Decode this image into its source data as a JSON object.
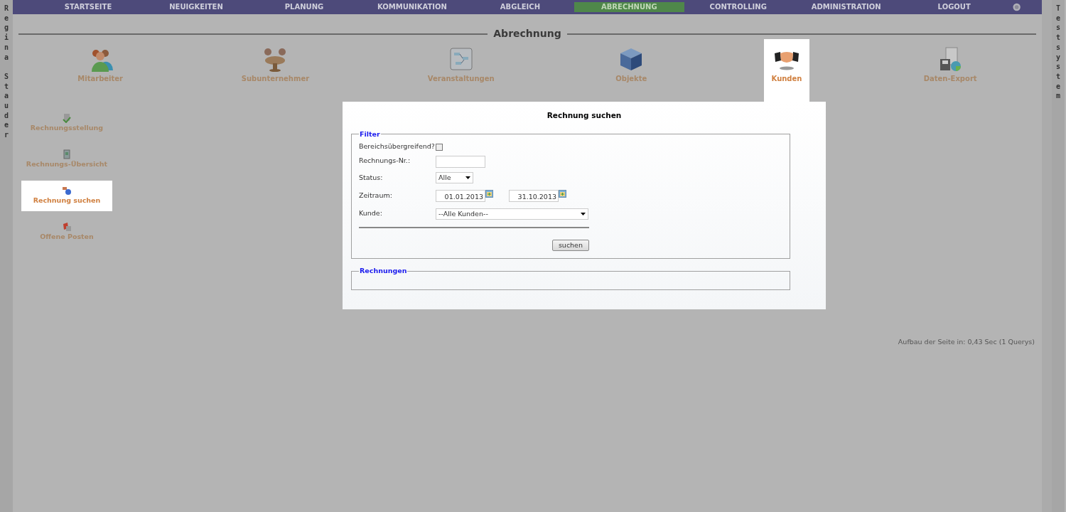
{
  "user_strip": "Regina Stauder",
  "system_strip": "Testsystem",
  "nav": [
    {
      "label": "STARTSEITE",
      "selected": false
    },
    {
      "label": "NEUIGKEITEN",
      "selected": false
    },
    {
      "label": "PLANUNG",
      "selected": false
    },
    {
      "label": "KOMMUNIKATION",
      "selected": false
    },
    {
      "label": "ABGLEICH",
      "selected": false
    },
    {
      "label": "ABRECHNUNG",
      "selected": true
    },
    {
      "label": "CONTROLLING",
      "selected": false
    },
    {
      "label": "ADMINISTRATION",
      "selected": false
    },
    {
      "label": "LOGOUT",
      "selected": false
    }
  ],
  "section_title": "Abrechnung",
  "modules": [
    {
      "kind": "people",
      "label": "Mitarbeiter",
      "selected": false
    },
    {
      "kind": "meeting",
      "label": "Subunternehmer",
      "selected": false
    },
    {
      "kind": "board",
      "label": "Veranstaltungen",
      "selected": false
    },
    {
      "kind": "cube",
      "label": "Objekte",
      "selected": false
    },
    {
      "kind": "handshake",
      "label": "Kunden",
      "selected": true
    },
    {
      "kind": "export",
      "label": "Daten-Export",
      "selected": false
    }
  ],
  "side_menu": [
    {
      "kind": "invoice",
      "label": "Rechnungsstellung",
      "selected": false
    },
    {
      "kind": "overview",
      "label": "Rechnungs-Übersicht",
      "selected": false
    },
    {
      "kind": "search",
      "label": "Rechnung suchen",
      "selected": true
    },
    {
      "kind": "open",
      "label": "Offene Posten",
      "selected": false
    }
  ],
  "dialog": {
    "title": "Rechnung suchen",
    "filter": {
      "legend": "Filter",
      "cross_area": {
        "label": "Bereichsübergreifend?",
        "checked": false
      },
      "number": {
        "label": "Rechnungs-Nr.:"
      },
      "status": {
        "label": "Status:",
        "value": "Alle"
      },
      "period": {
        "label": "Zeitraum:",
        "from": "01.01.2013",
        "to": "31.10.2013"
      },
      "customer": {
        "label": "Kunde:",
        "value": "--Alle Kunden--"
      },
      "button": "suchen"
    },
    "results": {
      "legend": "Rechnungen"
    }
  },
  "footer": "Aufbau der Seite in: 0,43 Sec (1 Querys)"
}
